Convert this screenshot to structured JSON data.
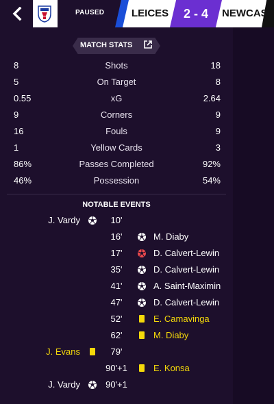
{
  "header": {
    "back_icon": "chevron-left-icon",
    "competition_logo": "fa-cup-logo",
    "status": "PAUSED",
    "home_team": "LEICES",
    "score": "2 - 4",
    "away_team": "NEWCAS",
    "colors": {
      "home": "#1a4ed8",
      "score_bg": "#6b2fd1",
      "away": "#111111"
    }
  },
  "match_stats": {
    "title": "MATCH STATS",
    "expand_icon": "external-link-icon",
    "rows": [
      {
        "label": "Shots",
        "home": "8",
        "away": "18"
      },
      {
        "label": "On Target",
        "home": "5",
        "away": "8"
      },
      {
        "label": "xG",
        "home": "0.55",
        "away": "2.64"
      },
      {
        "label": "Corners",
        "home": "9",
        "away": "9"
      },
      {
        "label": "Fouls",
        "home": "16",
        "away": "9"
      },
      {
        "label": "Yellow Cards",
        "home": "1",
        "away": "3"
      },
      {
        "label": "Passes Completed",
        "home": "86%",
        "away": "92%"
      },
      {
        "label": "Possession",
        "home": "46%",
        "away": "54%"
      }
    ]
  },
  "notable_events": {
    "title": "NOTABLE EVENTS",
    "events": [
      {
        "minute": "10'",
        "side": "home",
        "type": "goal",
        "player": "J. Vardy"
      },
      {
        "minute": "16'",
        "side": "away",
        "type": "goal",
        "player": "M. Diaby"
      },
      {
        "minute": "17'",
        "side": "away",
        "type": "goal-missed",
        "player": "D. Calvert-Lewin"
      },
      {
        "minute": "35'",
        "side": "away",
        "type": "goal",
        "player": "D. Calvert-Lewin"
      },
      {
        "minute": "41'",
        "side": "away",
        "type": "goal",
        "player": "A. Saint-Maximin"
      },
      {
        "minute": "47'",
        "side": "away",
        "type": "goal",
        "player": "D. Calvert-Lewin"
      },
      {
        "minute": "52'",
        "side": "away",
        "type": "yellow-card",
        "player": "E. Camavinga"
      },
      {
        "minute": "62'",
        "side": "away",
        "type": "yellow-card",
        "player": "M. Diaby"
      },
      {
        "minute": "79'",
        "side": "home",
        "type": "yellow-card",
        "player": "J. Evans"
      },
      {
        "minute": "90'+1",
        "side": "away",
        "type": "yellow-card",
        "player": "E. Konsa"
      },
      {
        "minute": "90'+1",
        "side": "home",
        "type": "goal",
        "player": "J. Vardy"
      }
    ]
  }
}
